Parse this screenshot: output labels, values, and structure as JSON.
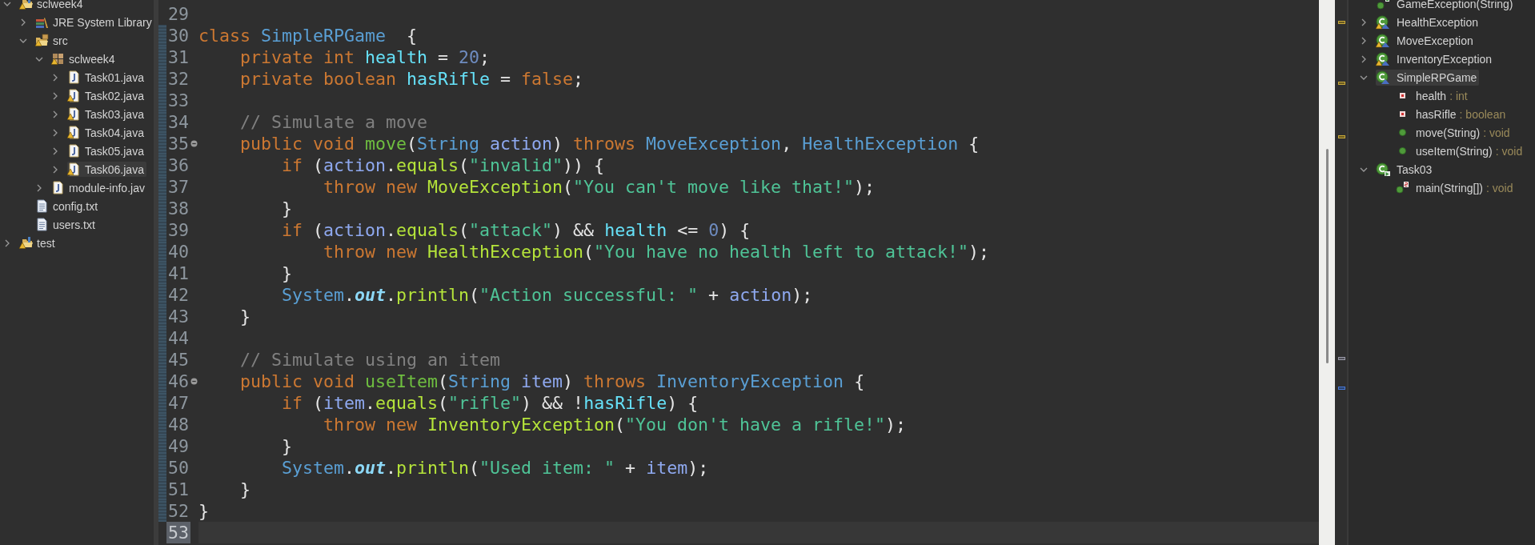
{
  "explorer": {
    "items": [
      {
        "label": "sclweek4",
        "kind": "project",
        "warning": true,
        "expanded": true,
        "selected": false,
        "children": [
          {
            "label": "JRE System Library",
            "kind": "library",
            "warning": false,
            "expanded": false,
            "selected": false
          },
          {
            "label": "src",
            "kind": "source",
            "warning": true,
            "expanded": true,
            "selected": false,
            "children": [
              {
                "label": "sclweek4",
                "kind": "package",
                "warning": true,
                "expanded": true,
                "selected": false,
                "children": [
                  {
                    "label": "Task01.java",
                    "kind": "java",
                    "warning": false,
                    "expanded": false,
                    "selected": false
                  },
                  {
                    "label": "Task02.java",
                    "kind": "java",
                    "warning": true,
                    "expanded": false,
                    "selected": false
                  },
                  {
                    "label": "Task03.java",
                    "kind": "java",
                    "warning": true,
                    "expanded": false,
                    "selected": false
                  },
                  {
                    "label": "Task04.java",
                    "kind": "java",
                    "warning": true,
                    "expanded": false,
                    "selected": false
                  },
                  {
                    "label": "Task05.java",
                    "kind": "java",
                    "warning": false,
                    "expanded": false,
                    "selected": false
                  },
                  {
                    "label": "Task06.java",
                    "kind": "java",
                    "warning": true,
                    "expanded": false,
                    "selected": true
                  }
                ]
              },
              {
                "label": "module-info.jav",
                "kind": "java",
                "warning": false,
                "expanded": false,
                "selected": false
              }
            ]
          },
          {
            "label": "config.txt",
            "kind": "text",
            "warning": false,
            "selected": false
          },
          {
            "label": "users.txt",
            "kind": "text",
            "warning": false,
            "selected": false
          }
        ]
      },
      {
        "label": "test",
        "kind": "project",
        "warning": true,
        "expanded": false,
        "selected": false
      }
    ]
  },
  "code": {
    "lines": [
      {
        "number": "29",
        "changed": false,
        "fold": false,
        "current": false
      },
      {
        "number": "30",
        "changed": true,
        "fold": false,
        "current": false,
        "tokens": [
          {
            "text": "class ",
            "kind": "kw"
          },
          {
            "text": "SimpleRPGame",
            "kind": "type"
          },
          {
            "text": "  {",
            "kind": "plain"
          }
        ]
      },
      {
        "number": "31",
        "changed": true,
        "fold": false,
        "current": false,
        "tokens": [
          {
            "text": "    private int ",
            "kind": "kw"
          },
          {
            "text": "health",
            "kind": "field"
          },
          {
            "text": " = ",
            "kind": "plain"
          },
          {
            "text": "20",
            "kind": "num"
          },
          {
            "text": ";",
            "kind": "plain"
          }
        ]
      },
      {
        "number": "32",
        "changed": true,
        "fold": false,
        "current": false,
        "tokens": [
          {
            "text": "    private boolean ",
            "kind": "kw"
          },
          {
            "text": "hasRifle",
            "kind": "field"
          },
          {
            "text": " = ",
            "kind": "plain"
          },
          {
            "text": "false",
            "kind": "kw"
          },
          {
            "text": ";",
            "kind": "plain"
          }
        ]
      },
      {
        "number": "33",
        "changed": true,
        "fold": false,
        "current": false
      },
      {
        "number": "34",
        "changed": true,
        "fold": false,
        "current": false,
        "tokens": [
          {
            "text": "    // Simulate a move",
            "kind": "comment"
          }
        ]
      },
      {
        "number": "35",
        "changed": true,
        "fold": true,
        "current": false,
        "tokens": [
          {
            "text": "    public void ",
            "kind": "kw"
          },
          {
            "text": "move",
            "kind": "decl"
          },
          {
            "text": "(",
            "kind": "plain"
          },
          {
            "text": "String ",
            "kind": "type"
          },
          {
            "text": "action",
            "kind": "param"
          },
          {
            "text": ") ",
            "kind": "plain"
          },
          {
            "text": "throws ",
            "kind": "kw"
          },
          {
            "text": "MoveException",
            "kind": "type"
          },
          {
            "text": ", ",
            "kind": "plain"
          },
          {
            "text": "HealthException",
            "kind": "type"
          },
          {
            "text": " {",
            "kind": "plain"
          }
        ]
      },
      {
        "number": "36",
        "changed": true,
        "fold": false,
        "current": false,
        "tokens": [
          {
            "text": "        if ",
            "kind": "kw"
          },
          {
            "text": "(",
            "kind": "plain"
          },
          {
            "text": "action",
            "kind": "param"
          },
          {
            "text": ".",
            "kind": "plain"
          },
          {
            "text": "equals",
            "kind": "call"
          },
          {
            "text": "(",
            "kind": "plain"
          },
          {
            "text": "\"invalid\"",
            "kind": "str"
          },
          {
            "text": ")) {",
            "kind": "plain"
          }
        ]
      },
      {
        "number": "37",
        "changed": true,
        "fold": false,
        "current": false,
        "tokens": [
          {
            "text": "            throw new ",
            "kind": "kw"
          },
          {
            "text": "MoveException",
            "kind": "call"
          },
          {
            "text": "(",
            "kind": "plain"
          },
          {
            "text": "\"You can't move like that!\"",
            "kind": "str"
          },
          {
            "text": ");",
            "kind": "plain"
          }
        ]
      },
      {
        "number": "38",
        "changed": true,
        "fold": false,
        "current": false,
        "tokens": [
          {
            "text": "        }",
            "kind": "plain"
          }
        ]
      },
      {
        "number": "39",
        "changed": true,
        "fold": false,
        "current": false,
        "tokens": [
          {
            "text": "        if ",
            "kind": "kw"
          },
          {
            "text": "(",
            "kind": "plain"
          },
          {
            "text": "action",
            "kind": "param"
          },
          {
            "text": ".",
            "kind": "plain"
          },
          {
            "text": "equals",
            "kind": "call"
          },
          {
            "text": "(",
            "kind": "plain"
          },
          {
            "text": "\"attack\"",
            "kind": "str"
          },
          {
            "text": ") && ",
            "kind": "plain"
          },
          {
            "text": "health",
            "kind": "field"
          },
          {
            "text": " <= ",
            "kind": "plain"
          },
          {
            "text": "0",
            "kind": "num"
          },
          {
            "text": ") {",
            "kind": "plain"
          }
        ]
      },
      {
        "number": "40",
        "changed": true,
        "fold": false,
        "current": false,
        "tokens": [
          {
            "text": "            throw new ",
            "kind": "kw"
          },
          {
            "text": "HealthException",
            "kind": "call"
          },
          {
            "text": "(",
            "kind": "plain"
          },
          {
            "text": "\"You have no health left to attack!\"",
            "kind": "str"
          },
          {
            "text": ");",
            "kind": "plain"
          }
        ]
      },
      {
        "number": "41",
        "changed": true,
        "fold": false,
        "current": false,
        "tokens": [
          {
            "text": "        }",
            "kind": "plain"
          }
        ]
      },
      {
        "number": "42",
        "changed": true,
        "fold": false,
        "current": false,
        "tokens": [
          {
            "text": "        System",
            "kind": "type"
          },
          {
            "text": ".",
            "kind": "plain"
          },
          {
            "text": "out",
            "kind": "static"
          },
          {
            "text": ".",
            "kind": "plain"
          },
          {
            "text": "println",
            "kind": "call"
          },
          {
            "text": "(",
            "kind": "plain"
          },
          {
            "text": "\"Action successful: \"",
            "kind": "str"
          },
          {
            "text": " + ",
            "kind": "plain"
          },
          {
            "text": "action",
            "kind": "param"
          },
          {
            "text": ");",
            "kind": "plain"
          }
        ]
      },
      {
        "number": "43",
        "changed": true,
        "fold": false,
        "current": false,
        "tokens": [
          {
            "text": "    }",
            "kind": "plain"
          }
        ]
      },
      {
        "number": "44",
        "changed": true,
        "fold": false,
        "current": false
      },
      {
        "number": "45",
        "changed": true,
        "fold": false,
        "current": false,
        "tokens": [
          {
            "text": "    // Simulate using an item",
            "kind": "comment"
          }
        ]
      },
      {
        "number": "46",
        "changed": true,
        "fold": true,
        "current": false,
        "tokens": [
          {
            "text": "    public void ",
            "kind": "kw"
          },
          {
            "text": "useItem",
            "kind": "decl"
          },
          {
            "text": "(",
            "kind": "plain"
          },
          {
            "text": "String ",
            "kind": "type"
          },
          {
            "text": "item",
            "kind": "param"
          },
          {
            "text": ") ",
            "kind": "plain"
          },
          {
            "text": "throws ",
            "kind": "kw"
          },
          {
            "text": "InventoryException",
            "kind": "type"
          },
          {
            "text": " {",
            "kind": "plain"
          }
        ]
      },
      {
        "number": "47",
        "changed": true,
        "fold": false,
        "current": false,
        "tokens": [
          {
            "text": "        if ",
            "kind": "kw"
          },
          {
            "text": "(",
            "kind": "plain"
          },
          {
            "text": "item",
            "kind": "param"
          },
          {
            "text": ".",
            "kind": "plain"
          },
          {
            "text": "equals",
            "kind": "call"
          },
          {
            "text": "(",
            "kind": "plain"
          },
          {
            "text": "\"rifle\"",
            "kind": "str"
          },
          {
            "text": ") && !",
            "kind": "plain"
          },
          {
            "text": "hasRifle",
            "kind": "field"
          },
          {
            "text": ") {",
            "kind": "plain"
          }
        ]
      },
      {
        "number": "48",
        "changed": true,
        "fold": false,
        "current": false,
        "tokens": [
          {
            "text": "            throw new ",
            "kind": "kw"
          },
          {
            "text": "InventoryException",
            "kind": "call"
          },
          {
            "text": "(",
            "kind": "plain"
          },
          {
            "text": "\"You don't have a rifle!\"",
            "kind": "str"
          },
          {
            "text": ");",
            "kind": "plain"
          }
        ]
      },
      {
        "number": "49",
        "changed": true,
        "fold": false,
        "current": false,
        "tokens": [
          {
            "text": "        }",
            "kind": "plain"
          }
        ]
      },
      {
        "number": "50",
        "changed": true,
        "fold": false,
        "current": false,
        "tokens": [
          {
            "text": "        System",
            "kind": "type"
          },
          {
            "text": ".",
            "kind": "plain"
          },
          {
            "text": "out",
            "kind": "static"
          },
          {
            "text": ".",
            "kind": "plain"
          },
          {
            "text": "println",
            "kind": "call"
          },
          {
            "text": "(",
            "kind": "plain"
          },
          {
            "text": "\"Used item: \"",
            "kind": "str"
          },
          {
            "text": " + ",
            "kind": "plain"
          },
          {
            "text": "item",
            "kind": "param"
          },
          {
            "text": ");",
            "kind": "plain"
          }
        ]
      },
      {
        "number": "51",
        "changed": true,
        "fold": false,
        "current": false,
        "tokens": [
          {
            "text": "    }",
            "kind": "plain"
          }
        ]
      },
      {
        "number": "52",
        "changed": true,
        "fold": false,
        "current": false,
        "tokens": [
          {
            "text": "}",
            "kind": "plain"
          }
        ]
      },
      {
        "number": "53",
        "changed": false,
        "fold": false,
        "current": true
      }
    ]
  },
  "outline": {
    "items": [
      {
        "label": "GameException(String)",
        "kind": "method",
        "constructor": true,
        "selected": false
      },
      {
        "label": "HealthException",
        "kind": "class",
        "warning": true,
        "expanded": false,
        "selected": false
      },
      {
        "label": "MoveException",
        "kind": "class",
        "warning": true,
        "expanded": false,
        "selected": false
      },
      {
        "label": "InventoryException",
        "kind": "class",
        "warning": true,
        "expanded": false,
        "selected": false
      },
      {
        "label": "SimpleRPGame",
        "kind": "class",
        "warning": false,
        "expanded": true,
        "selected": true,
        "children": [
          {
            "label": "health",
            "detail": ": int",
            "kind": "field",
            "selected": false
          },
          {
            "label": "hasRifle",
            "detail": ": boolean",
            "kind": "field",
            "selected": false
          },
          {
            "label": "move(String)",
            "detail": ": void",
            "kind": "method",
            "selected": false
          },
          {
            "label": "useItem(String)",
            "detail": ": void",
            "kind": "method",
            "selected": false
          }
        ]
      },
      {
        "label": "Task03",
        "kind": "class",
        "warning": false,
        "runnable": true,
        "expanded": true,
        "selected": false,
        "children": [
          {
            "label": "main(String[])",
            "detail": ": void",
            "kind": "method",
            "static": true,
            "selected": false
          }
        ]
      }
    ]
  }
}
